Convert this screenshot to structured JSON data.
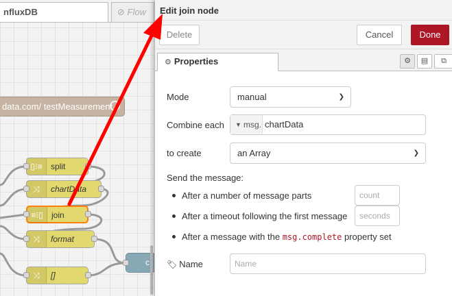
{
  "workspace": {
    "tabs": [
      {
        "label": "nfluxDB",
        "active": true
      },
      {
        "label": "⊘ Flow",
        "active": false
      }
    ],
    "nodes": {
      "mqtt_label": "data.com/ testMeasurement",
      "split": "split",
      "chartData": "chartData",
      "join": "join",
      "format": "format",
      "arr": "[]",
      "teal": "c"
    }
  },
  "tray": {
    "title": "Edit join node",
    "delete_label": "Delete",
    "cancel_label": "Cancel",
    "done_label": "Done",
    "properties_tab": "Properties"
  },
  "form": {
    "mode_label": "Mode",
    "mode_value": "manual",
    "combine_label": "Combine each",
    "combine_type": "msg.",
    "combine_value": "chartData",
    "create_label": "to create",
    "create_value": "an Array",
    "send_label": "Send the message:",
    "parts_text": "After a number of message parts",
    "parts_placeholder": "count",
    "timeout_text": "After a timeout following the first message",
    "timeout_placeholder": "seconds",
    "complete_pre": "After a message with the ",
    "complete_code": "msg.complete",
    "complete_post": " property set",
    "name_label": "Name",
    "name_placeholder": "Name"
  },
  "colors": {
    "done": "#ad1625",
    "function_node": "#e2d96e",
    "mqtt_node": "#c7b3a1",
    "join_highlight": "#ff7f0e",
    "arrow": "#ff0000"
  }
}
